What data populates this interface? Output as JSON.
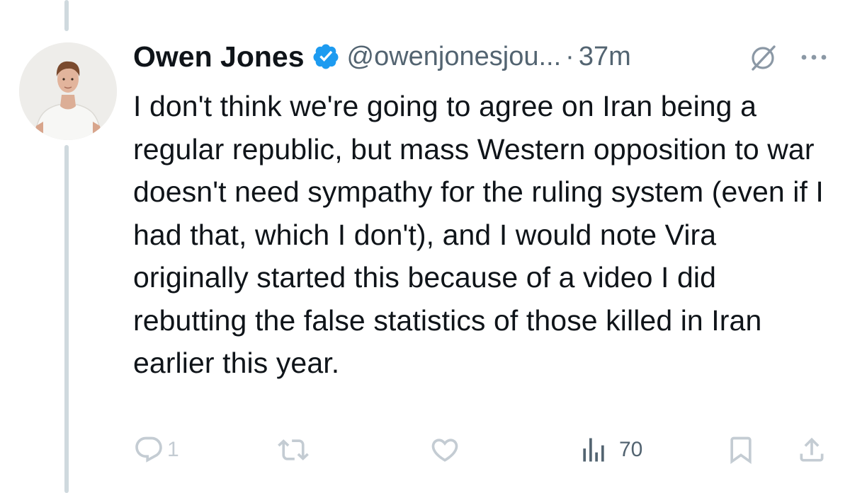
{
  "tweet": {
    "display_name": "Owen Jones",
    "handle": "@owenjonesjou...",
    "separator": "·",
    "time": "37m",
    "text": "I don't think we're going to agree on Iran being a regular republic, but mass Western opposition to war doesn't need sympathy for the ruling system (even if I had that, which I don't), and I would note Vira originally started this because of a video I did rebutting the false statistics of those killed in Iran earlier this year."
  },
  "actions": {
    "reply_count": "1",
    "views_count": "70"
  },
  "icons": {
    "verified": "verified-badge-icon",
    "grok": "grok-icon",
    "more": "more-icon",
    "reply": "reply-icon",
    "retweet": "retweet-icon",
    "like": "like-icon",
    "views": "views-icon",
    "bookmark": "bookmark-icon",
    "share": "share-icon"
  },
  "colors": {
    "text": "#0f1419",
    "secondary": "#536471",
    "verified": "#1d9bf0",
    "action_icons": "#b7c2cb",
    "thread_line": "#cfd9de"
  }
}
